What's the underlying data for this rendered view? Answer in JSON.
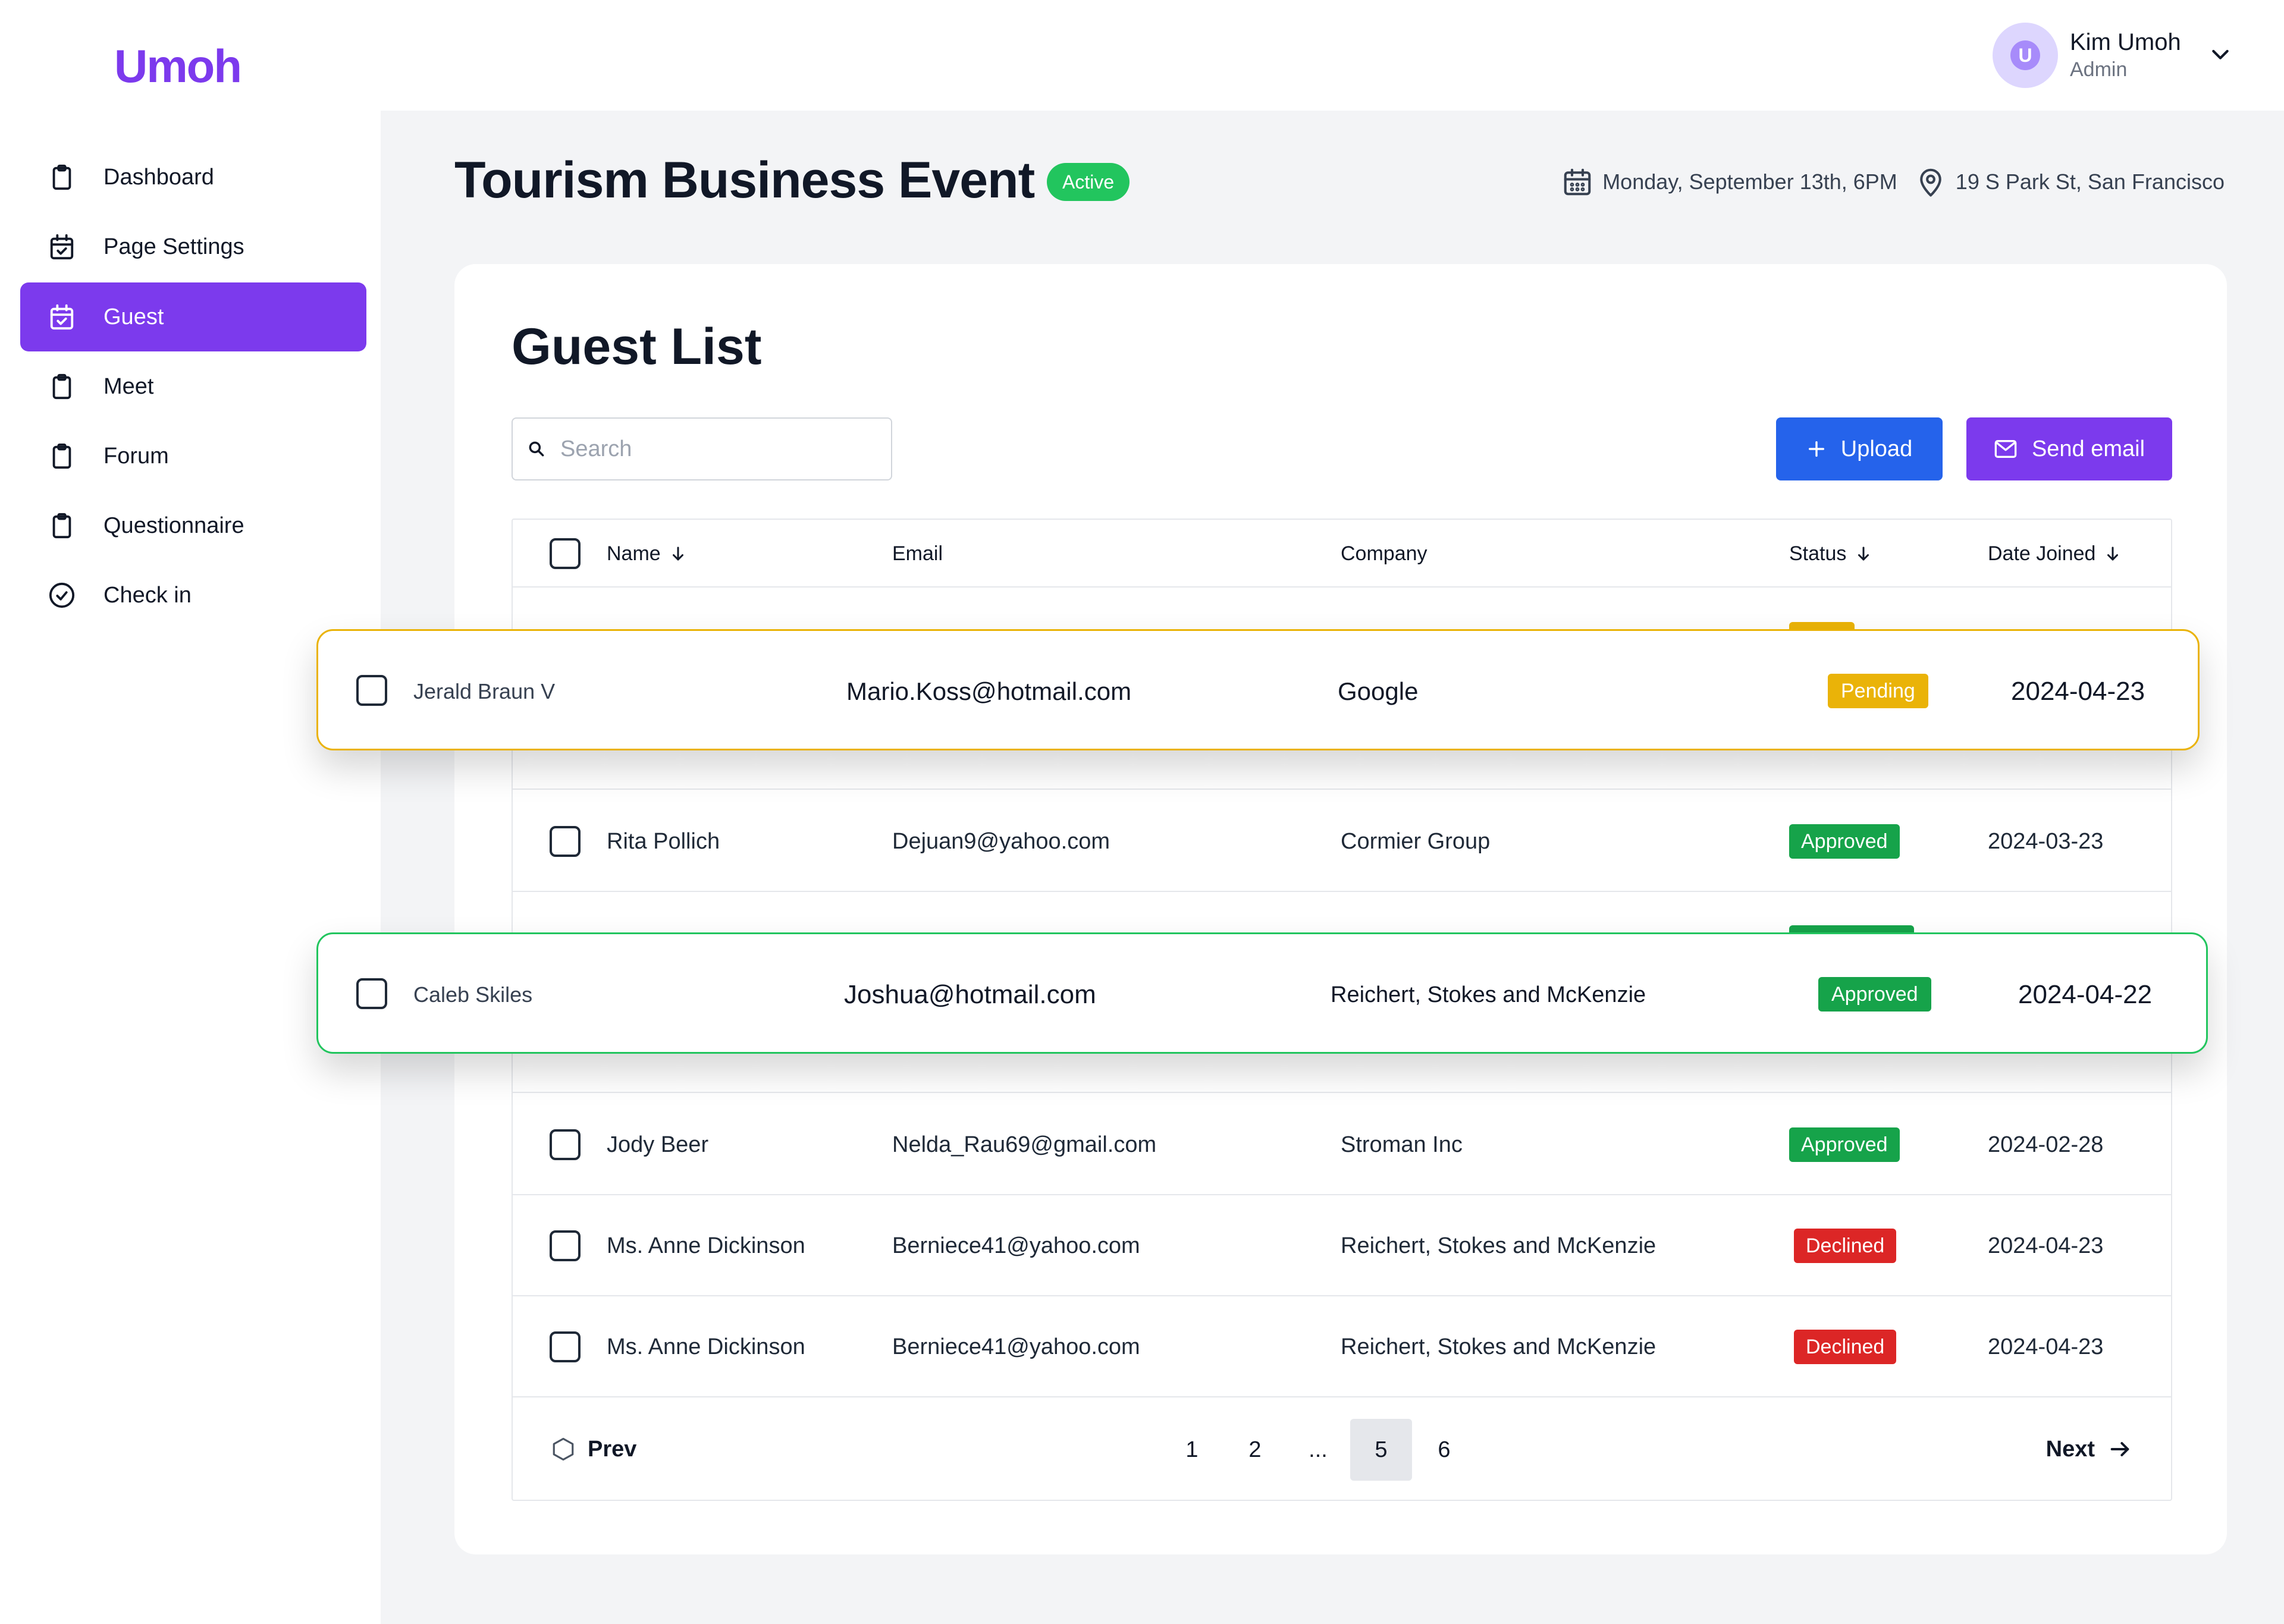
{
  "app": {
    "logo": "Umoh"
  },
  "user": {
    "name": "Kim Umoh",
    "role": "Admin",
    "avatar_initial": "U"
  },
  "sidebar": {
    "items": [
      {
        "label": "Dashboard",
        "icon": "clipboard-icon",
        "active": false
      },
      {
        "label": "Page Settings",
        "icon": "calendar-check-icon",
        "active": false
      },
      {
        "label": "Guest",
        "icon": "calendar-check-icon",
        "active": true
      },
      {
        "label": "Meet",
        "icon": "clipboard-icon",
        "active": false
      },
      {
        "label": "Forum",
        "icon": "clipboard-icon",
        "active": false
      },
      {
        "label": "Questionnaire",
        "icon": "clipboard-icon",
        "active": false
      },
      {
        "label": "Check in",
        "icon": "check-circle-icon",
        "active": false
      }
    ]
  },
  "event": {
    "title": "Tourism Business Event",
    "status": "Active",
    "date": "Monday, September 13th, 6PM",
    "location": "19 S Park St, San Francisco"
  },
  "guest_list": {
    "title": "Guest List",
    "search_placeholder": "Search",
    "upload_label": "Upload",
    "send_email_label": "Send email",
    "columns": {
      "name": "Name",
      "email": "Email",
      "company": "Company",
      "status": "Status",
      "date_joined": "Date Joined"
    },
    "rows": [
      {
        "name": "Rita Pollich",
        "email": "Dejuan9@yahoo.com",
        "company": "Cormier Group",
        "status": "Approved",
        "date": "2024-03-23"
      },
      {
        "name": "Jody Beer",
        "email": "Nelda_Rau69@gmail.com",
        "company": "Stroman Inc",
        "status": "Approved",
        "date": "2024-02-28"
      },
      {
        "name": "Ms. Anne Dickinson",
        "email": "Berniece41@yahoo.com",
        "company": "Reichert, Stokes and McKenzie",
        "status": "Declined",
        "date": "2024-04-23"
      },
      {
        "name": "Ms. Anne Dickinson",
        "email": "Berniece41@yahoo.com",
        "company": "Reichert, Stokes and McKenzie",
        "status": "Declined",
        "date": "2024-04-23"
      }
    ],
    "highlighted_rows": [
      {
        "name": "Jerald Braun V",
        "email": "Mario.Koss@hotmail.com",
        "company": "Google",
        "status": "Pending",
        "date": "2024-04-23"
      },
      {
        "name": "Caleb Skiles",
        "email": "Joshua@hotmail.com",
        "company": "Reichert, Stokes and McKenzie",
        "status": "Approved",
        "date": "2024-04-22"
      }
    ],
    "pagination": {
      "prev": "Prev",
      "next": "Next",
      "pages": [
        "1",
        "2",
        "...",
        "5",
        "6"
      ],
      "current": "5"
    }
  },
  "colors": {
    "brand": "#7c3aed",
    "upload": "#2563eb",
    "approved": "#16a34a",
    "declined": "#dc2626",
    "pending": "#eab308",
    "active_badge": "#22c55e"
  }
}
